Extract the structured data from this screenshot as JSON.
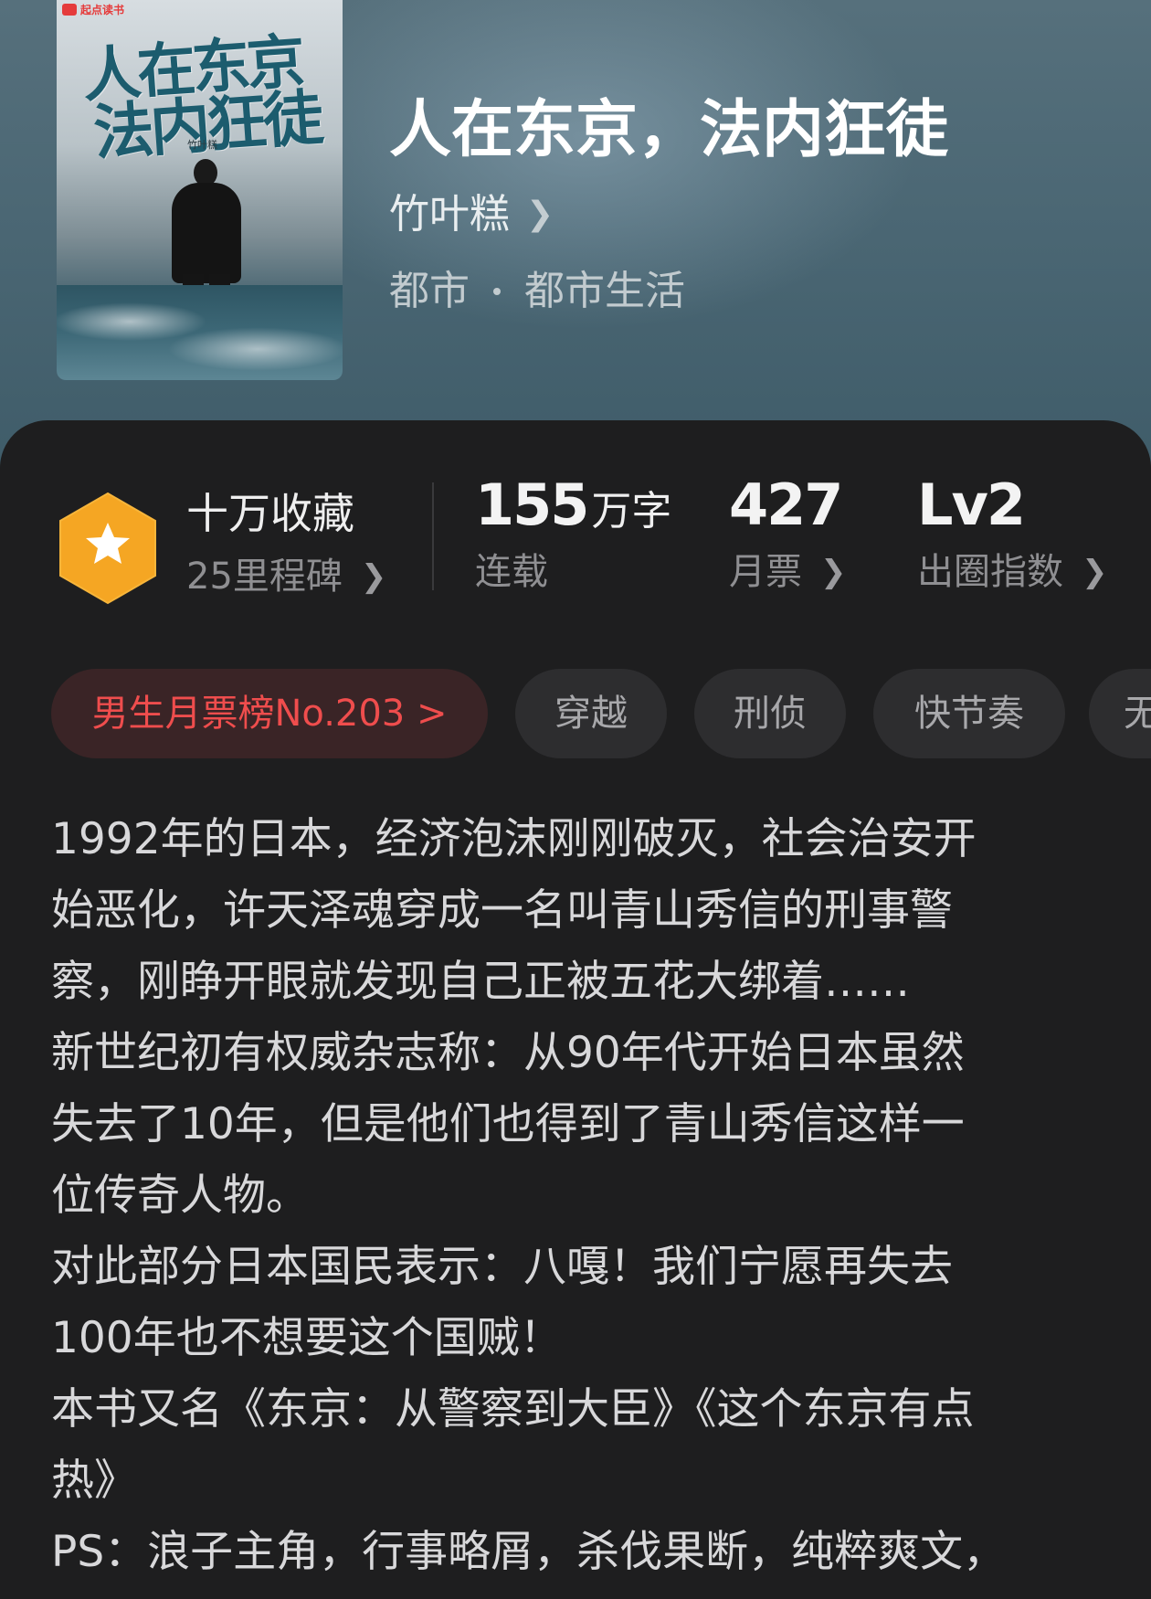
{
  "book": {
    "cover": {
      "brand": "起点读书",
      "title_line1": "人在东京",
      "title_line2": "法内狂徒",
      "author": "竹叶糕"
    },
    "title": "人在东京，法内狂徒",
    "author": "竹叶糕",
    "category": "都市",
    "subcategory": "都市生活"
  },
  "stats": {
    "collection": {
      "title": "十万收藏",
      "subtitle": "25里程碑",
      "badge_color": "#f5a623",
      "badge_icon": "star-icon"
    },
    "words": {
      "number": "155",
      "unit": "万字",
      "label": "连载"
    },
    "monthly_ticket": {
      "number": "427",
      "label": "月票"
    },
    "influence": {
      "number": "Lv2",
      "label": "出圈指数"
    }
  },
  "tags": [
    "男生月票榜No.203 >",
    "穿越",
    "刑侦",
    "快节奏",
    "无"
  ],
  "synopsis_lines": [
    "1992年的日本，经济泡沫刚刚破灭，社会治安开",
    "始恶化，许天泽魂穿成一名叫青山秀信的刑事警",
    "察，刚睁开眼就发现自己正被五花大绑着……",
    "新世纪初有权威杂志称：从90年代开始日本虽然",
    "失去了10年，但是他们也得到了青山秀信这样一",
    "位传奇人物。",
    "对此部分日本国民表示：八嘎！我们宁愿再失去",
    "100年也不想要这个国贼！",
    "本书又名《东京：从警察到大臣》《这个东京有点",
    "热》",
    "PS：浪子主角，行事略屑，杀伐果断，纯粹爽文，"
  ],
  "colors": {
    "header_bg": "#4b6774",
    "card_bg": "#1e1e1f",
    "rank_tag_text": "#ef4d4d",
    "rank_tag_bg": "#3a2426"
  }
}
